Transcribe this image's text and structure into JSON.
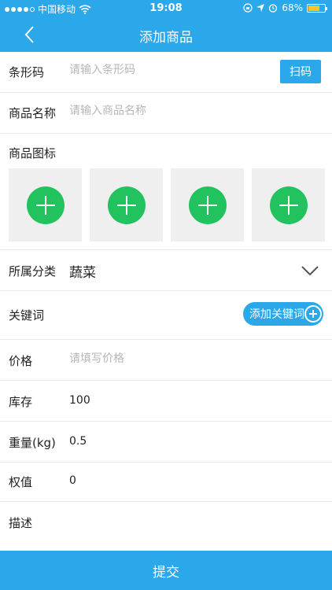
{
  "status_bar": {
    "carrier": "中国移动",
    "time": "19:08",
    "battery": "68%",
    "battery_level": 0.68,
    "icons": [
      "signal-dots-icon",
      "wifi-icon",
      "lock-rotation-icon",
      "location-arrow-icon",
      "alarm-icon",
      "battery-icon"
    ]
  },
  "nav": {
    "title": "添加商品",
    "back_icon": "chevron-left-icon"
  },
  "form": {
    "barcode": {
      "label": "条形码",
      "placeholder": "请输入条形码",
      "scan_label": "扫码"
    },
    "name": {
      "label": "商品名称",
      "placeholder": "请输入商品名称"
    },
    "images": {
      "label": "商品图标",
      "slot_icon": "add-circle-icon"
    },
    "category": {
      "label": "所属分类",
      "value": "蔬菜",
      "dropdown_icon": "chevron-down-icon"
    },
    "keywords": {
      "label": "关键词",
      "add_label": "添加关键词",
      "add_icon": "plus-circle-icon"
    },
    "price": {
      "label": "价格",
      "placeholder": "请填写价格"
    },
    "stock": {
      "label": "库存",
      "value": "100"
    },
    "weight": {
      "label": "重量(kg)",
      "value": "0.5"
    },
    "weight_value": {
      "label": "权值",
      "value": "0"
    },
    "description": {
      "label": "描述"
    }
  },
  "submit": {
    "label": "提交"
  },
  "colors": {
    "primary": "#2aa8ea",
    "add_green": "#22c35e",
    "slot_bg": "#efefef",
    "battery": "#f3c623"
  }
}
